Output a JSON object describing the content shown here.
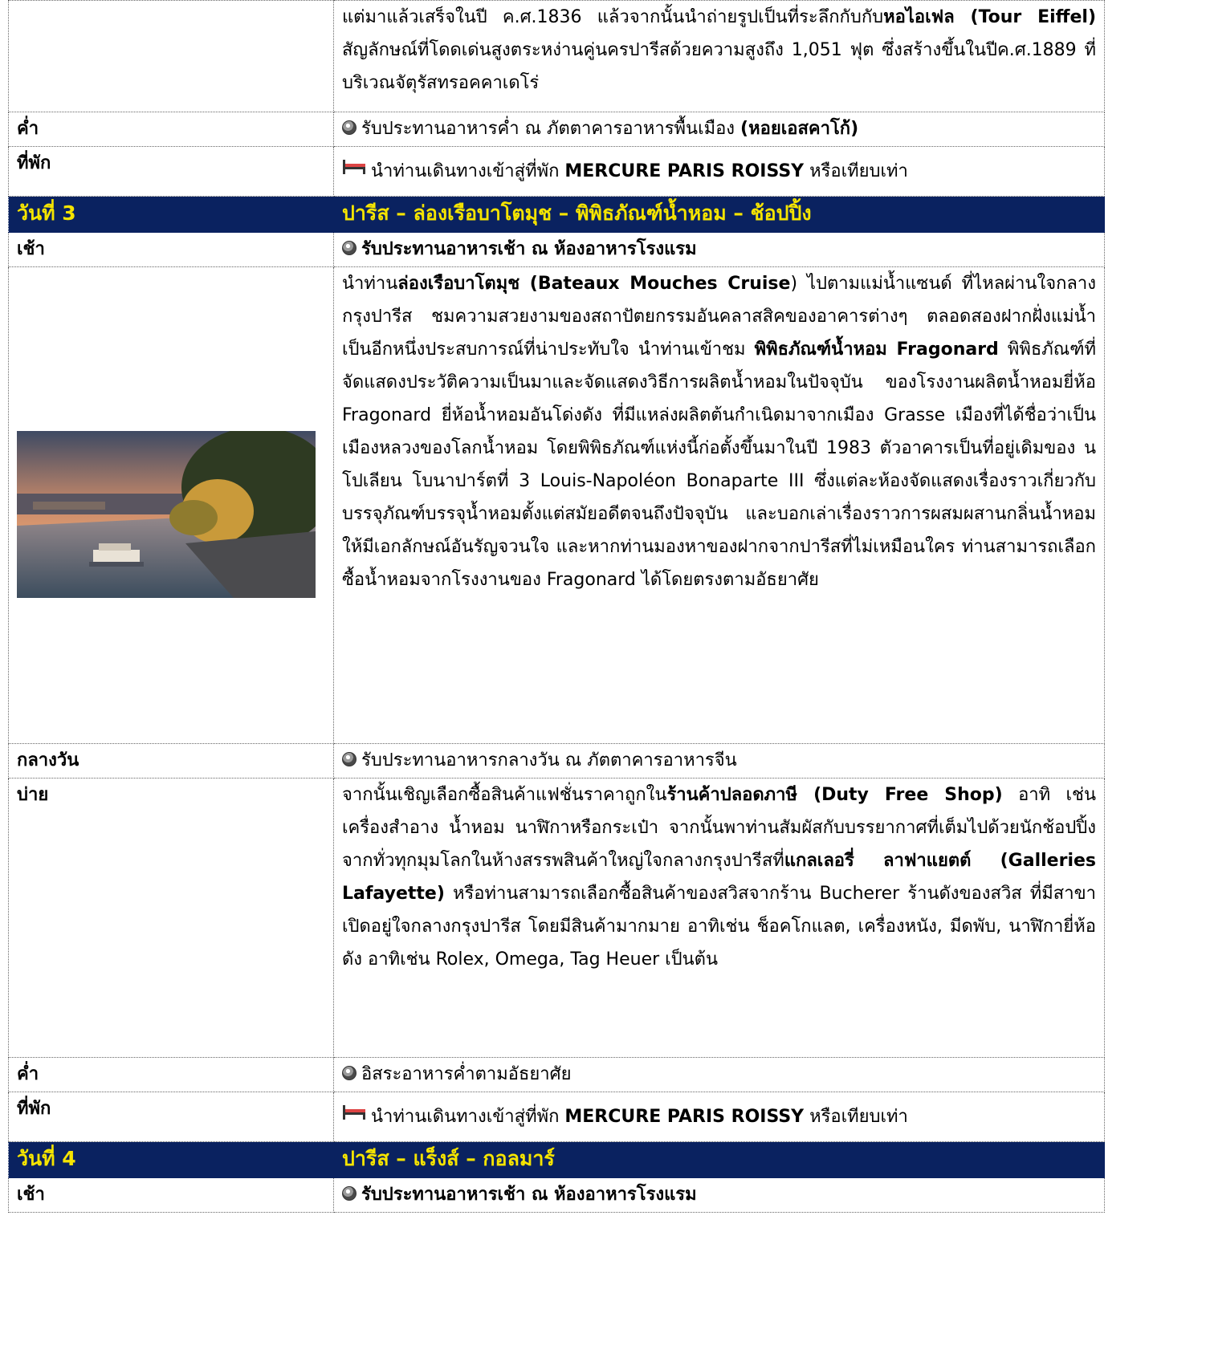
{
  "r0": {
    "t1": "แต่มาแล้วเสร็จในปี ค.ศ.1836 แล้วจากนั้นนำถ่ายรูปเป็นที่ระลึกกับกับ",
    "t2": "หอไอเฟล (Tour Eiffel)",
    "t3": " สัญลักษณ์ที่โดดเด่นสูงตระหง่านคู่นครปารีสด้วยความสูงถึง 1,051 ฟุต ซึ่งสร้างขึ้นในปีค.ศ.1889 ที่บริเวณจัตุรัสทรอคคาเดโร่"
  },
  "r1": {
    "label": "ค่ำ",
    "t1": "รับประทานอาหารค่ำ ณ ภัตตาคารอาหารพื้นเมือง ",
    "t2": "(หอยเอสคาโก้)"
  },
  "r2": {
    "label": "ที่พัก",
    "t1": "นำท่านเดินทางเข้าสู่ที่พัก ",
    "t2": "MERCURE PARIS ROISSY",
    "t3": " หรือเทียบเท่า"
  },
  "r3": {
    "label": "วันที่ 3",
    "title": "ปารีส – ล่องเรือบาโตมุช – พิพิธภัณฑ์น้ำหอม – ช้อปปิ้ง"
  },
  "r4": {
    "label": "เช้า",
    "t1": "รับประทานอาหารเช้า ณ ห้องอาหารโรงแรม"
  },
  "r5": {
    "t1": "นำท่าน",
    "t2": "ล่องเรือบาโตมุช (Bateaux Mouches Cruise",
    "t3": ") ไปตามแม่น้ำแซนด์ ที่ไหลผ่านใจกลางกรุงปารีส ชมความสวยงามของสถาปัตยกรรมอันคลาสสิคของอาคารต่างๆ ตลอดสองฝากฝั่งแม่น้ำ เป็นอีกหนึ่งประสบการณ์ที่น่าประทับใจ นำท่านเข้าชม ",
    "t4": "พิพิธภัณฑ์น้ำหอม Fragonard",
    "t5": " พิพิธภัณฑ์ที่จัดแสดงประวัติความเป็นมาและจัดแสดงวิธีการผลิตน้ำหอมในปัจจุบัน ของโรงงานผลิตน้ำหอมยี่ห้อ Fragonard ยี่ห้อน้ำหอมอันโด่งดัง ที่มีแหล่งผลิตต้นกำเนิดมาจากเมือง Grasse เมืองที่ได้ชื่อว่าเป็นเมืองหลวงของโลกน้ำหอม โดยพิพิธภัณฑ์แห่งนี้ก่อตั้งขึ้นมาในปี 1983 ตัวอาคารเป็นที่อยู่เดิมของ นโปเลียน โบนาปาร์ตที่ 3 Louis-Napoléon Bonaparte III ซึ่งแต่ละห้องจัดแสดงเรื่องราวเกี่ยวกับบรรจุภัณฑ์บรรจุน้ำหอมตั้งแต่สมัยอดีตจนถึงปัจจุบัน และบอกเล่าเรื่องราวการผสมผสานกลิ่นน้ำหอมให้มีเอกลักษณ์อันรัญจวนใจ และหากท่านมองหาของฝากจากปารีสที่ไม่เหมือนใคร ท่านสามารถเลือกซื้อน้ำหอมจากโรงงานของ Fragonard ได้โดยตรงตามอัธยาศัย"
  },
  "r6": {
    "label": "กลางวัน",
    "t1": "รับประทานอาหารกลางวัน ณ ภัตตาคารอาหารจีน"
  },
  "r7": {
    "label": "บ่าย",
    "t1": "จากนั้นเชิญเลือกซื้อสินค้าแฟชั่นราคาถูกใน",
    "t2": "ร้านค้าปลอดภาษี (Duty Free Shop)",
    "t3": " อาทิ เช่น เครื่องสำอาง น้ำหอม นาฬิกาหรือกระเป๋า จากนั้นพาท่านสัมผัสกับบรรยากาศที่เต็มไปด้วยนักช้อปปิ้งจากทั่วทุกมุมโลกในห้างสรรพสินค้าใหญ่ใจกลางกรุงปารีสที่",
    "t4": "แกลเลอรี่ ลาฟาแยตต์ (Galleries Lafayette)",
    "t5": " หรือท่านสามารถเลือกซื้อสินค้าของสวิสจากร้าน Bucherer ร้านดังของสวิส ที่มีสาขาเปิดอยู่ใจกลางกรุงปารีส โดยมีสินค้ามากมาย อาทิเช่น ช็อคโกแลต, เครื่องหนัง, มีดพับ, นาฬิกายี่ห้อดัง อาทิเช่น Rolex, Omega, Tag Heuer เป็นต้น"
  },
  "r8": {
    "label": "ค่ำ",
    "t1": "อิสระอาหารค่ำตามอัธยาศัย"
  },
  "r9": {
    "label": "ที่พัก",
    "t1": "นำท่านเดินทางเข้าสู่ที่พัก ",
    "t2": "MERCURE PARIS ROISSY",
    "t3": " หรือเทียบเท่า"
  },
  "r10": {
    "label": "วันที่ 4",
    "title": "ปารีส – แร็งส์ – กอลมาร์"
  },
  "r11": {
    "label": "เช้า",
    "t1": "รับประทานอาหารเช้า ณ ห้องอาหารโรงแรม"
  },
  "icons": {
    "meal": "meal-icon",
    "bed": "bed-icon"
  },
  "colors": {
    "day_header_bg": "#0a2260",
    "day_header_text": "#f5e400"
  }
}
